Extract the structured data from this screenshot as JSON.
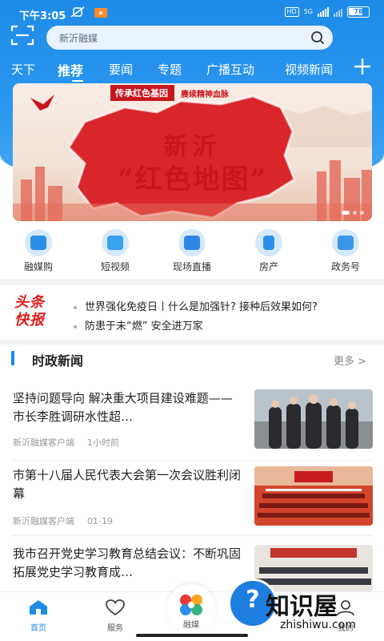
{
  "status_bar": {
    "time": "下午3:05",
    "network": "HD",
    "network_type": "5G",
    "battery": "78",
    "battery_level": 0.78
  },
  "search": {
    "placeholder": "新沂融媒"
  },
  "tabs": [
    {
      "label": "天下"
    },
    {
      "label": "推荐",
      "active": true
    },
    {
      "label": "要闻"
    },
    {
      "label": "专题"
    },
    {
      "label": "广播互动"
    },
    {
      "label": "视频新闻"
    }
  ],
  "banner": {
    "tag": "传承红色基因",
    "tag_sub": "赓续精神血脉",
    "line1": "新沂",
    "line2": "“红色地图”"
  },
  "quick_entries": [
    {
      "label": "融媒购",
      "icon": "shopping-bag-icon"
    },
    {
      "label": "短视频",
      "icon": "play-icon"
    },
    {
      "label": "现场直播",
      "icon": "video-camera-icon"
    },
    {
      "label": "房产",
      "icon": "building-icon"
    },
    {
      "label": "政务号",
      "icon": "government-icon"
    }
  ],
  "ticker": {
    "logo_line1": "头条",
    "logo_line2": "快报",
    "items": [
      "世界强化免疫日丨什么是加强针? 接种后效果如何?",
      "防患于未“燃” 安全进万家"
    ]
  },
  "section": {
    "title": "时政新闻",
    "more": "更多 >"
  },
  "news": [
    {
      "title": "坚持问题导向 解决重大项目建设难题——市长李胜调研水性超…",
      "source": "新沂融媒客户端",
      "time": "1小时前"
    },
    {
      "title": "市第十八届人民代表大会第一次会议胜利闭幕",
      "source": "新沂融媒客户端",
      "time": "01-19"
    },
    {
      "title": "我市召开党史学习教育总结会议：不断巩固拓展党史学习教育成…",
      "source": "",
      "time": ""
    }
  ],
  "bottom_nav": [
    {
      "label": "首页",
      "icon": "home-icon",
      "active": true
    },
    {
      "label": "服务",
      "icon": "heart-icon"
    },
    {
      "label": "融媒",
      "icon": "pinwheel-icon"
    },
    {
      "label": "我的",
      "icon": "user-icon"
    }
  ],
  "watermark": {
    "brand": "知识屋",
    "url": "zhishiwu.com"
  },
  "colors": {
    "primary": "#1e8be8",
    "red": "#c8161d",
    "ticker_red": "#e0201c"
  }
}
